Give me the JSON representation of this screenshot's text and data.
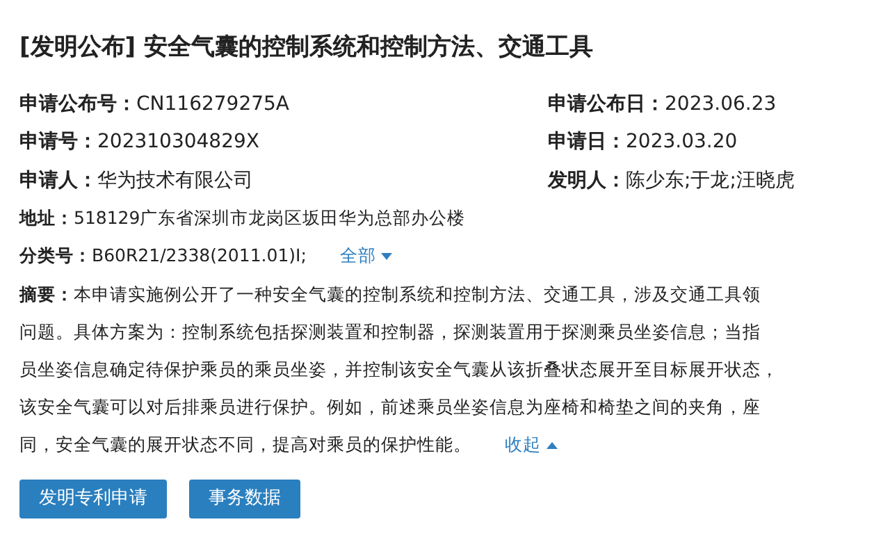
{
  "title": "[发明公布] 安全气囊的控制系统和控制方法、交通工具",
  "fields": [
    {
      "label": "申请公布号：",
      "value": "CN116279275A",
      "label2": "申请公布日：",
      "value2": "2023.06.23"
    },
    {
      "label": "申请号：",
      "value": "202310304829X",
      "label2": "申请日：",
      "value2": "2023.03.20"
    },
    {
      "label": "申请人：",
      "value": "华为技术有限公司",
      "label2": "发明人：",
      "value2": "陈少东;于龙;汪晓虎"
    }
  ],
  "address": {
    "label": "地址：",
    "value": "518129广东省深圳市龙岗区坂田华为总部办公楼"
  },
  "classification": {
    "label": "分类号：",
    "value": "B60R21/2338(2011.01)I;",
    "toggle": "全部",
    "expanded": false
  },
  "abstract": {
    "label": "摘要：",
    "lines": [
      "本申请实施例公开了一种安全气囊的控制系统和控制方法、交通工具，涉及交通工具领",
      "问题。具体方案为：控制系统包括探测装置和控制器，探测装置用于探测乘员坐姿信息；当指",
      "员坐姿信息确定待保护乘员的乘员坐姿，并控制该安全气囊从该折叠状态展开至目标展开状态，",
      "该安全气囊可以对后排乘员进行保护。例如，前述乘员坐姿信息为座椅和椅垫之间的夹角，座",
      "同，安全气囊的展开状态不同，提高对乘员的保护性能。"
    ],
    "toggle": "收起",
    "expanded": true
  },
  "buttons": [
    "发明专利申请",
    "事务数据"
  ]
}
